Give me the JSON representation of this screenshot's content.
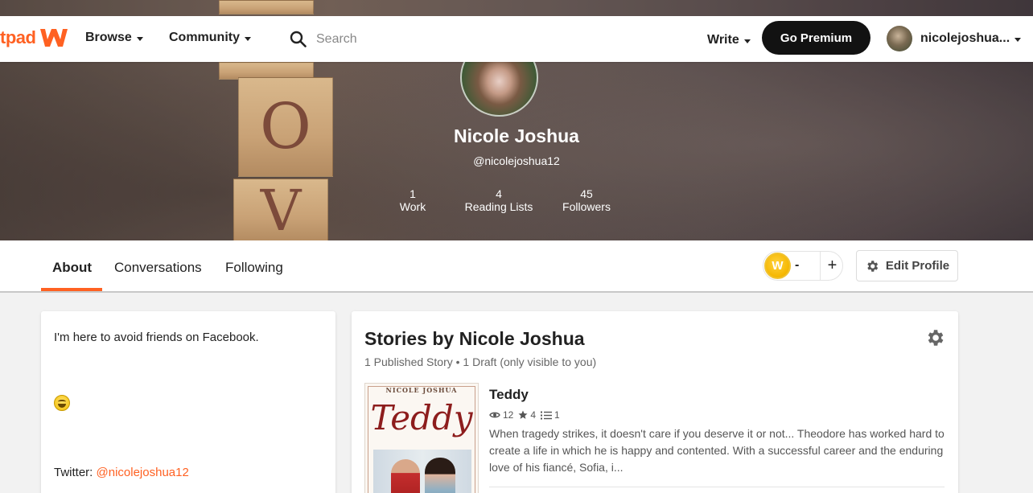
{
  "nav": {
    "logo_text": "tpad",
    "browse": "Browse",
    "community": "Community",
    "search_placeholder": "Search",
    "write": "Write",
    "go_premium": "Go Premium",
    "username": "nicolejoshua..."
  },
  "profile": {
    "name": "Nicole Joshua",
    "handle": "@nicolejoshua12",
    "stats": [
      {
        "value": "1",
        "label": "Work"
      },
      {
        "value": "4",
        "label": "Reading Lists"
      },
      {
        "value": "45",
        "label": "Followers"
      }
    ]
  },
  "tabs": [
    {
      "label": "About"
    },
    {
      "label": "Conversations"
    },
    {
      "label": "Following"
    }
  ],
  "coins": {
    "badge": "W",
    "count": "-",
    "plus": "+"
  },
  "edit_profile": "Edit Profile",
  "about": {
    "bio": "I'm here to avoid friends on Facebook.",
    "twitter_label": "Twitter: ",
    "twitter_handle": "@nicolejoshua12"
  },
  "stories": {
    "title": "Stories by Nicole Joshua",
    "subtitle": "1 Published Story • 1 Draft (only visible to you)",
    "items": [
      {
        "title": "Teddy",
        "cover_author": "NICOLE JOSHUA",
        "cover_title": "Teddy",
        "reads": "12",
        "votes": "4",
        "parts": "1",
        "description": "When tragedy strikes, it doesn't care if you deserve it or not... Theodore has worked hard to create a life in which he is happy and contented. With a successful career and the enduring love of his fiancé, Sofia, i..."
      }
    ]
  },
  "hero_letters": [
    "O",
    "V"
  ],
  "colors": {
    "accent": "#ff6122",
    "premium_bg": "#121212"
  }
}
